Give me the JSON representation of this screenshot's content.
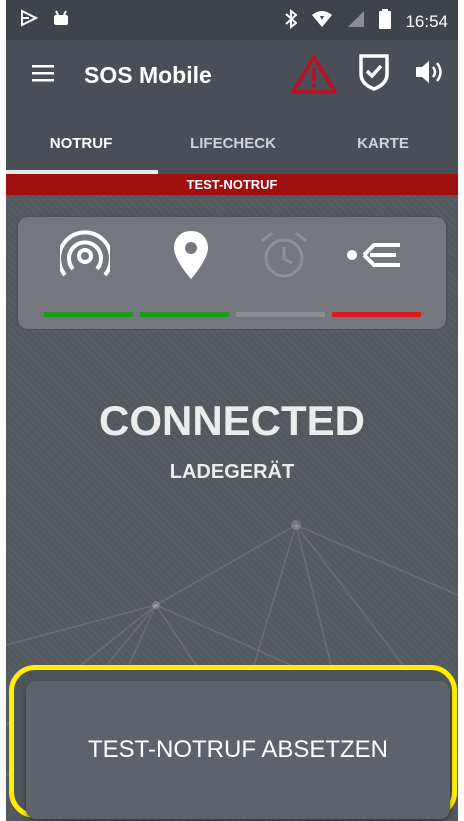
{
  "status_bar": {
    "time": "16:54",
    "left_icons": [
      "play-store-icon",
      "android-icon"
    ],
    "right_icons": [
      "bluetooth-icon",
      "wifi-icon",
      "signal-icon",
      "battery-icon"
    ]
  },
  "app_bar": {
    "title": "SOS Mobile",
    "icons": [
      "menu-icon",
      "warning-icon",
      "shield-check-icon",
      "speaker-icon"
    ]
  },
  "tabs": [
    {
      "label": "NOTRUF",
      "active": true
    },
    {
      "label": "LIFECHECK",
      "active": false
    },
    {
      "label": "KARTE",
      "active": false
    }
  ],
  "banner": {
    "label": "TEST-NOTRUF",
    "color": "#a00f0f"
  },
  "status_panel": {
    "items": [
      {
        "icon": "signal-broadcast-icon",
        "status_color": "#1a9a1a"
      },
      {
        "icon": "location-pin-icon",
        "status_color": "#1a9a1a"
      },
      {
        "icon": "alarm-clock-icon",
        "status_color": "#8a8d92"
      },
      {
        "icon": "man-down-icon",
        "status_color": "#e01818"
      }
    ]
  },
  "connection": {
    "state": "CONNECTED",
    "detail": "LADEGERÄT"
  },
  "action": {
    "label": "TEST-NOTRUF ABSETZEN",
    "highlight_color": "#ffee00"
  }
}
